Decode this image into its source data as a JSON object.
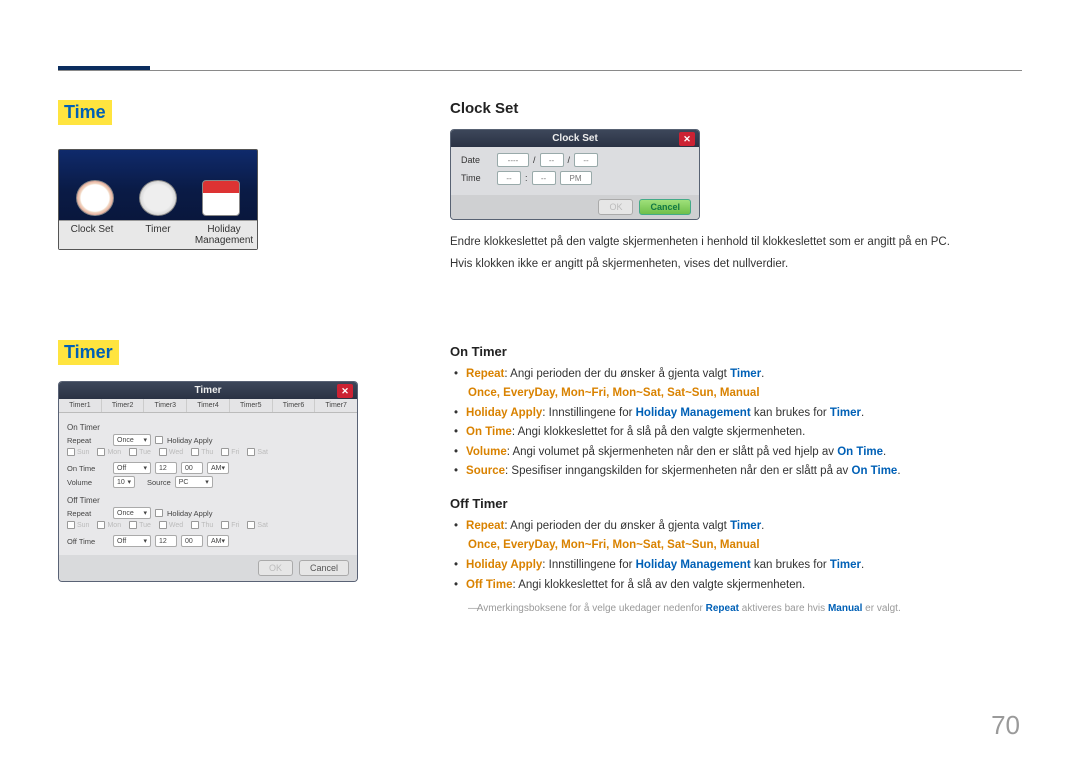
{
  "page_number": "70",
  "left": {
    "time_heading": "Time",
    "timer_heading": "Timer",
    "time_icons": {
      "clock": "Clock Set",
      "timer": "Timer",
      "holiday": "Holiday Management"
    },
    "timer_dlg": {
      "title": "Timer",
      "tabs": [
        "Timer1",
        "Timer2",
        "Timer3",
        "Timer4",
        "Timer5",
        "Timer6",
        "Timer7"
      ],
      "onTimerLbl": "On Timer",
      "repeatLbl": "Repeat",
      "repeatVal": "Once",
      "holidayApply": "Holiday Apply",
      "days": [
        "Sun",
        "Mon",
        "Tue",
        "Wed",
        "Thu",
        "Fri",
        "Sat"
      ],
      "onTimeLbl": "On Time",
      "onTimeState": "Off",
      "on_h": "12",
      "on_m": "00",
      "on_ampm": "AM",
      "volumeLbl": "Volume",
      "volume": "10",
      "sourceLbl": "Source",
      "source": "PC",
      "offTimerLbl": "Off Timer",
      "offTimeLbl": "Off Time",
      "offTimeState": "Off",
      "off_h": "12",
      "off_m": "00",
      "off_ampm": "AM",
      "ok": "OK",
      "cancel": "Cancel"
    }
  },
  "right": {
    "clockset_heading": "Clock Set",
    "clockset_dlg": {
      "title": "Clock Set",
      "date": "Date",
      "time": "Time",
      "d1": "----",
      "d2": "--",
      "d3": "--",
      "t1": "--",
      "t2": "--",
      "t3": "PM",
      "ok": "OK",
      "cancel": "Cancel"
    },
    "clockset_desc1": "Endre klokkeslettet på den valgte skjermenheten i henhold til klokkeslettet som er angitt på en PC.",
    "clockset_desc2": "Hvis klokken ikke er angitt på skjermenheten, vises det nullverdier.",
    "ontimer_heading": "On Timer",
    "ontimer": {
      "b_repeat": "Repeat",
      "repeat_txt": ": Angi perioden der du ønsker å gjenta valgt ",
      "k_timer": "Timer",
      "dot": ".",
      "opts": "Once, EveryDay, Mon~Fri, Mon~Sat, Sat~Sun, Manual",
      "b_happly": "Holiday Apply",
      "happly_txt": ": Innstillingene for ",
      "k_hm": "Holiday Management",
      "happly_txt2": " kan brukes for ",
      "b_ontime": "On Time",
      "ontime_txt": ": Angi klokkeslettet for å slå på den valgte skjermenheten.",
      "b_volume": "Volume",
      "vol_txt": ": Angi volumet på skjermenheten når den er slått på ved hjelp av ",
      "b_source": "Source",
      "src_txt": ": Spesifiser inngangskilden for skjermenheten når den er slått på av "
    },
    "offtimer_heading": "Off Timer",
    "offtimer": {
      "b_repeat": "Repeat",
      "repeat_txt": ": Angi perioden der du ønsker å gjenta valgt ",
      "opts": "Once, EveryDay, Mon~Fri, Mon~Sat, Sat~Sun, Manual",
      "b_happly": "Holiday Apply",
      "happly_txt": ": Innstillingene for ",
      "b_offtime": "Off Time",
      "offtime_txt": ": Angi klokkeslettet for å slå av den valgte skjermenheten.",
      "note1": "Avmerkingsboksene for å velge ukedager nedenfor ",
      "note_repeat": "Repeat",
      "note2": " aktiveres bare hvis ",
      "note_manual": "Manual",
      "note3": " er valgt."
    },
    "k_ontime2": "On Time"
  }
}
